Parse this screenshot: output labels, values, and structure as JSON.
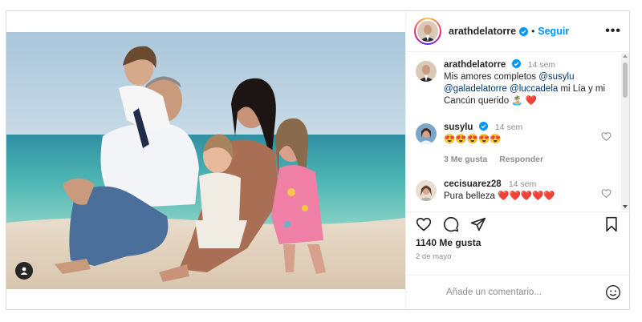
{
  "post": {
    "author": "arathdelatorre",
    "follow_label": "Seguir",
    "dot": "•",
    "more_icon": "more-horizontal-icon"
  },
  "caption": {
    "user": "arathdelatorre",
    "time": "14 sem",
    "text_before": "Mis amores completos ",
    "mention1": "@susylu",
    "mention2": "@galadelatorre",
    "mention3": "@luccadela",
    "text_after": " mi Lía y mi Cancún querido 🏝️ ❤️"
  },
  "comments": [
    {
      "user": "susylu",
      "verified": true,
      "time": "14 sem",
      "text": "😍😍😍😍😍",
      "likes": "3 Me gusta",
      "reply": "Responder"
    },
    {
      "user": "cecisuarez28",
      "verified": false,
      "time": "14 sem",
      "text": "Pura belleza ❤️❤️❤️❤️❤️"
    }
  ],
  "likes_count": "1140 Me gusta",
  "date": "2 de mayo",
  "comment_input": {
    "placeholder": "Añade un comentario..."
  },
  "icons": [
    "heart-icon",
    "comment-icon",
    "share-icon",
    "bookmark-icon",
    "emoji-icon",
    "user-tag-icon",
    "verified-icon"
  ],
  "colors": {
    "accent": "#0095f6",
    "verified": "#0095f6",
    "heart": "#ed4956"
  }
}
